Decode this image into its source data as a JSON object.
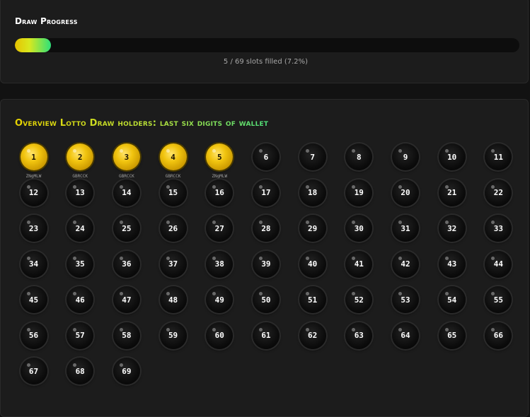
{
  "progress": {
    "title": "Draw Progress",
    "text": "5 / 69 slots filled (7.2%)",
    "fraction": 0.072,
    "gradient_colors": [
      "#e6c200",
      "#d8e81f",
      "#2ee07a"
    ]
  },
  "overview": {
    "title": "Overview Lotto Draw holders: last six digits of wallet",
    "slots": [
      {
        "n": "1",
        "wallet": "ZNgMLW",
        "filled": true
      },
      {
        "n": "2",
        "wallet": "GBRCCK",
        "filled": true
      },
      {
        "n": "3",
        "wallet": "GBRCCK",
        "filled": true
      },
      {
        "n": "4",
        "wallet": "GBRCCK",
        "filled": true
      },
      {
        "n": "5",
        "wallet": "ZNgMLW",
        "filled": true
      },
      {
        "n": "6"
      },
      {
        "n": "7"
      },
      {
        "n": "8"
      },
      {
        "n": "9"
      },
      {
        "n": "10"
      },
      {
        "n": "11"
      },
      {
        "n": "12"
      },
      {
        "n": "13"
      },
      {
        "n": "14"
      },
      {
        "n": "15"
      },
      {
        "n": "16"
      },
      {
        "n": "17"
      },
      {
        "n": "18"
      },
      {
        "n": "19"
      },
      {
        "n": "20"
      },
      {
        "n": "21"
      },
      {
        "n": "22"
      },
      {
        "n": "23"
      },
      {
        "n": "24"
      },
      {
        "n": "25"
      },
      {
        "n": "26"
      },
      {
        "n": "27"
      },
      {
        "n": "28"
      },
      {
        "n": "29"
      },
      {
        "n": "30"
      },
      {
        "n": "31"
      },
      {
        "n": "32"
      },
      {
        "n": "33"
      },
      {
        "n": "34"
      },
      {
        "n": "35"
      },
      {
        "n": "36"
      },
      {
        "n": "37"
      },
      {
        "n": "38"
      },
      {
        "n": "39"
      },
      {
        "n": "40"
      },
      {
        "n": "41"
      },
      {
        "n": "42"
      },
      {
        "n": "43"
      },
      {
        "n": "44"
      },
      {
        "n": "45"
      },
      {
        "n": "46"
      },
      {
        "n": "47"
      },
      {
        "n": "48"
      },
      {
        "n": "49"
      },
      {
        "n": "50"
      },
      {
        "n": "51"
      },
      {
        "n": "52"
      },
      {
        "n": "53"
      },
      {
        "n": "54"
      },
      {
        "n": "55"
      },
      {
        "n": "56"
      },
      {
        "n": "57"
      },
      {
        "n": "58"
      },
      {
        "n": "59"
      },
      {
        "n": "60"
      },
      {
        "n": "61"
      },
      {
        "n": "62"
      },
      {
        "n": "63"
      },
      {
        "n": "64"
      },
      {
        "n": "65"
      },
      {
        "n": "66"
      },
      {
        "n": "67"
      },
      {
        "n": "68"
      },
      {
        "n": "69"
      }
    ]
  },
  "colors": {
    "filled_ball": "#f1c40f",
    "empty_ball": "#0c0c0c",
    "background": "#121212",
    "panel": "#1c1c1c"
  }
}
